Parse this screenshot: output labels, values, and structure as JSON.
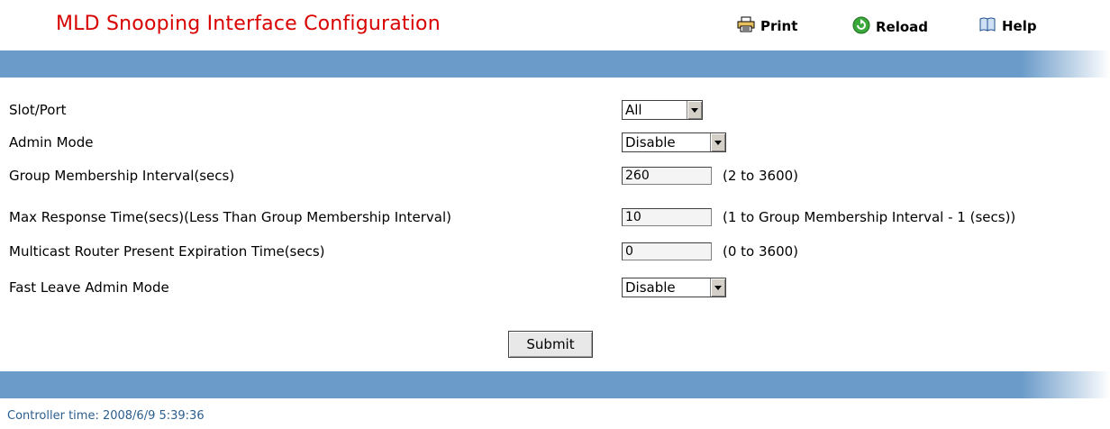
{
  "page": {
    "title": "MLD Snooping Interface Configuration"
  },
  "toolbar": {
    "print_label": "Print",
    "reload_label": "Reload",
    "help_label": "Help"
  },
  "form": {
    "slot_port": {
      "label": "Slot/Port",
      "value": "All"
    },
    "admin_mode": {
      "label": "Admin Mode",
      "value": "Disable"
    },
    "group_membership_interval": {
      "label": "Group Membership Interval(secs)",
      "value": "260",
      "hint": "(2 to 3600)"
    },
    "max_response_time": {
      "label": "Max Response Time(secs)(Less Than Group Membership Interval)",
      "value": "10",
      "hint": "(1 to Group Membership Interval - 1 (secs))"
    },
    "mcast_router_expiration": {
      "label": "Multicast Router Present Expiration Time(secs)",
      "value": "0",
      "hint": "(0 to 3600)"
    },
    "fast_leave_admin_mode": {
      "label": "Fast Leave Admin Mode",
      "value": "Disable"
    },
    "submit_label": "Submit"
  },
  "footer": {
    "controller_time": "Controller time: 2008/6/9 5:39:36"
  },
  "colors": {
    "title": "#d80000",
    "bar": "#6a9bc9",
    "footer_text": "#2a5e8f"
  },
  "icons": {
    "print": "printer-icon",
    "reload": "reload-icon",
    "help": "help-book-icon"
  }
}
